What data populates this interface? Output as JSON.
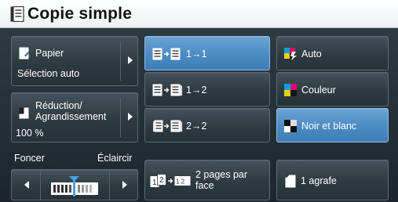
{
  "title": "Copie simple",
  "paper": {
    "label": "Papier",
    "value": "Sélection auto"
  },
  "reduce": {
    "label": "Réduction/\nAgrandissement",
    "value": "100 %"
  },
  "density": {
    "darker": "Foncer",
    "lighter": "Éclaircir"
  },
  "sides": [
    {
      "label": "1→1",
      "selected": true
    },
    {
      "label": "1→2",
      "selected": false
    },
    {
      "label": "2→2",
      "selected": false
    }
  ],
  "pages_per_side": {
    "label": "2 pages par\nface",
    "tile_a": "1",
    "tile_b": "2",
    "tile_c": "1 2"
  },
  "color_mode": [
    {
      "label": "Auto",
      "selected": false
    },
    {
      "label": "Couleur",
      "selected": false
    },
    {
      "label": "Noir et blanc",
      "selected": true
    }
  ],
  "staple": {
    "label": "1 agrafe"
  },
  "colors": {
    "accent": "#4a88c0",
    "tile": "#2e3a41"
  }
}
